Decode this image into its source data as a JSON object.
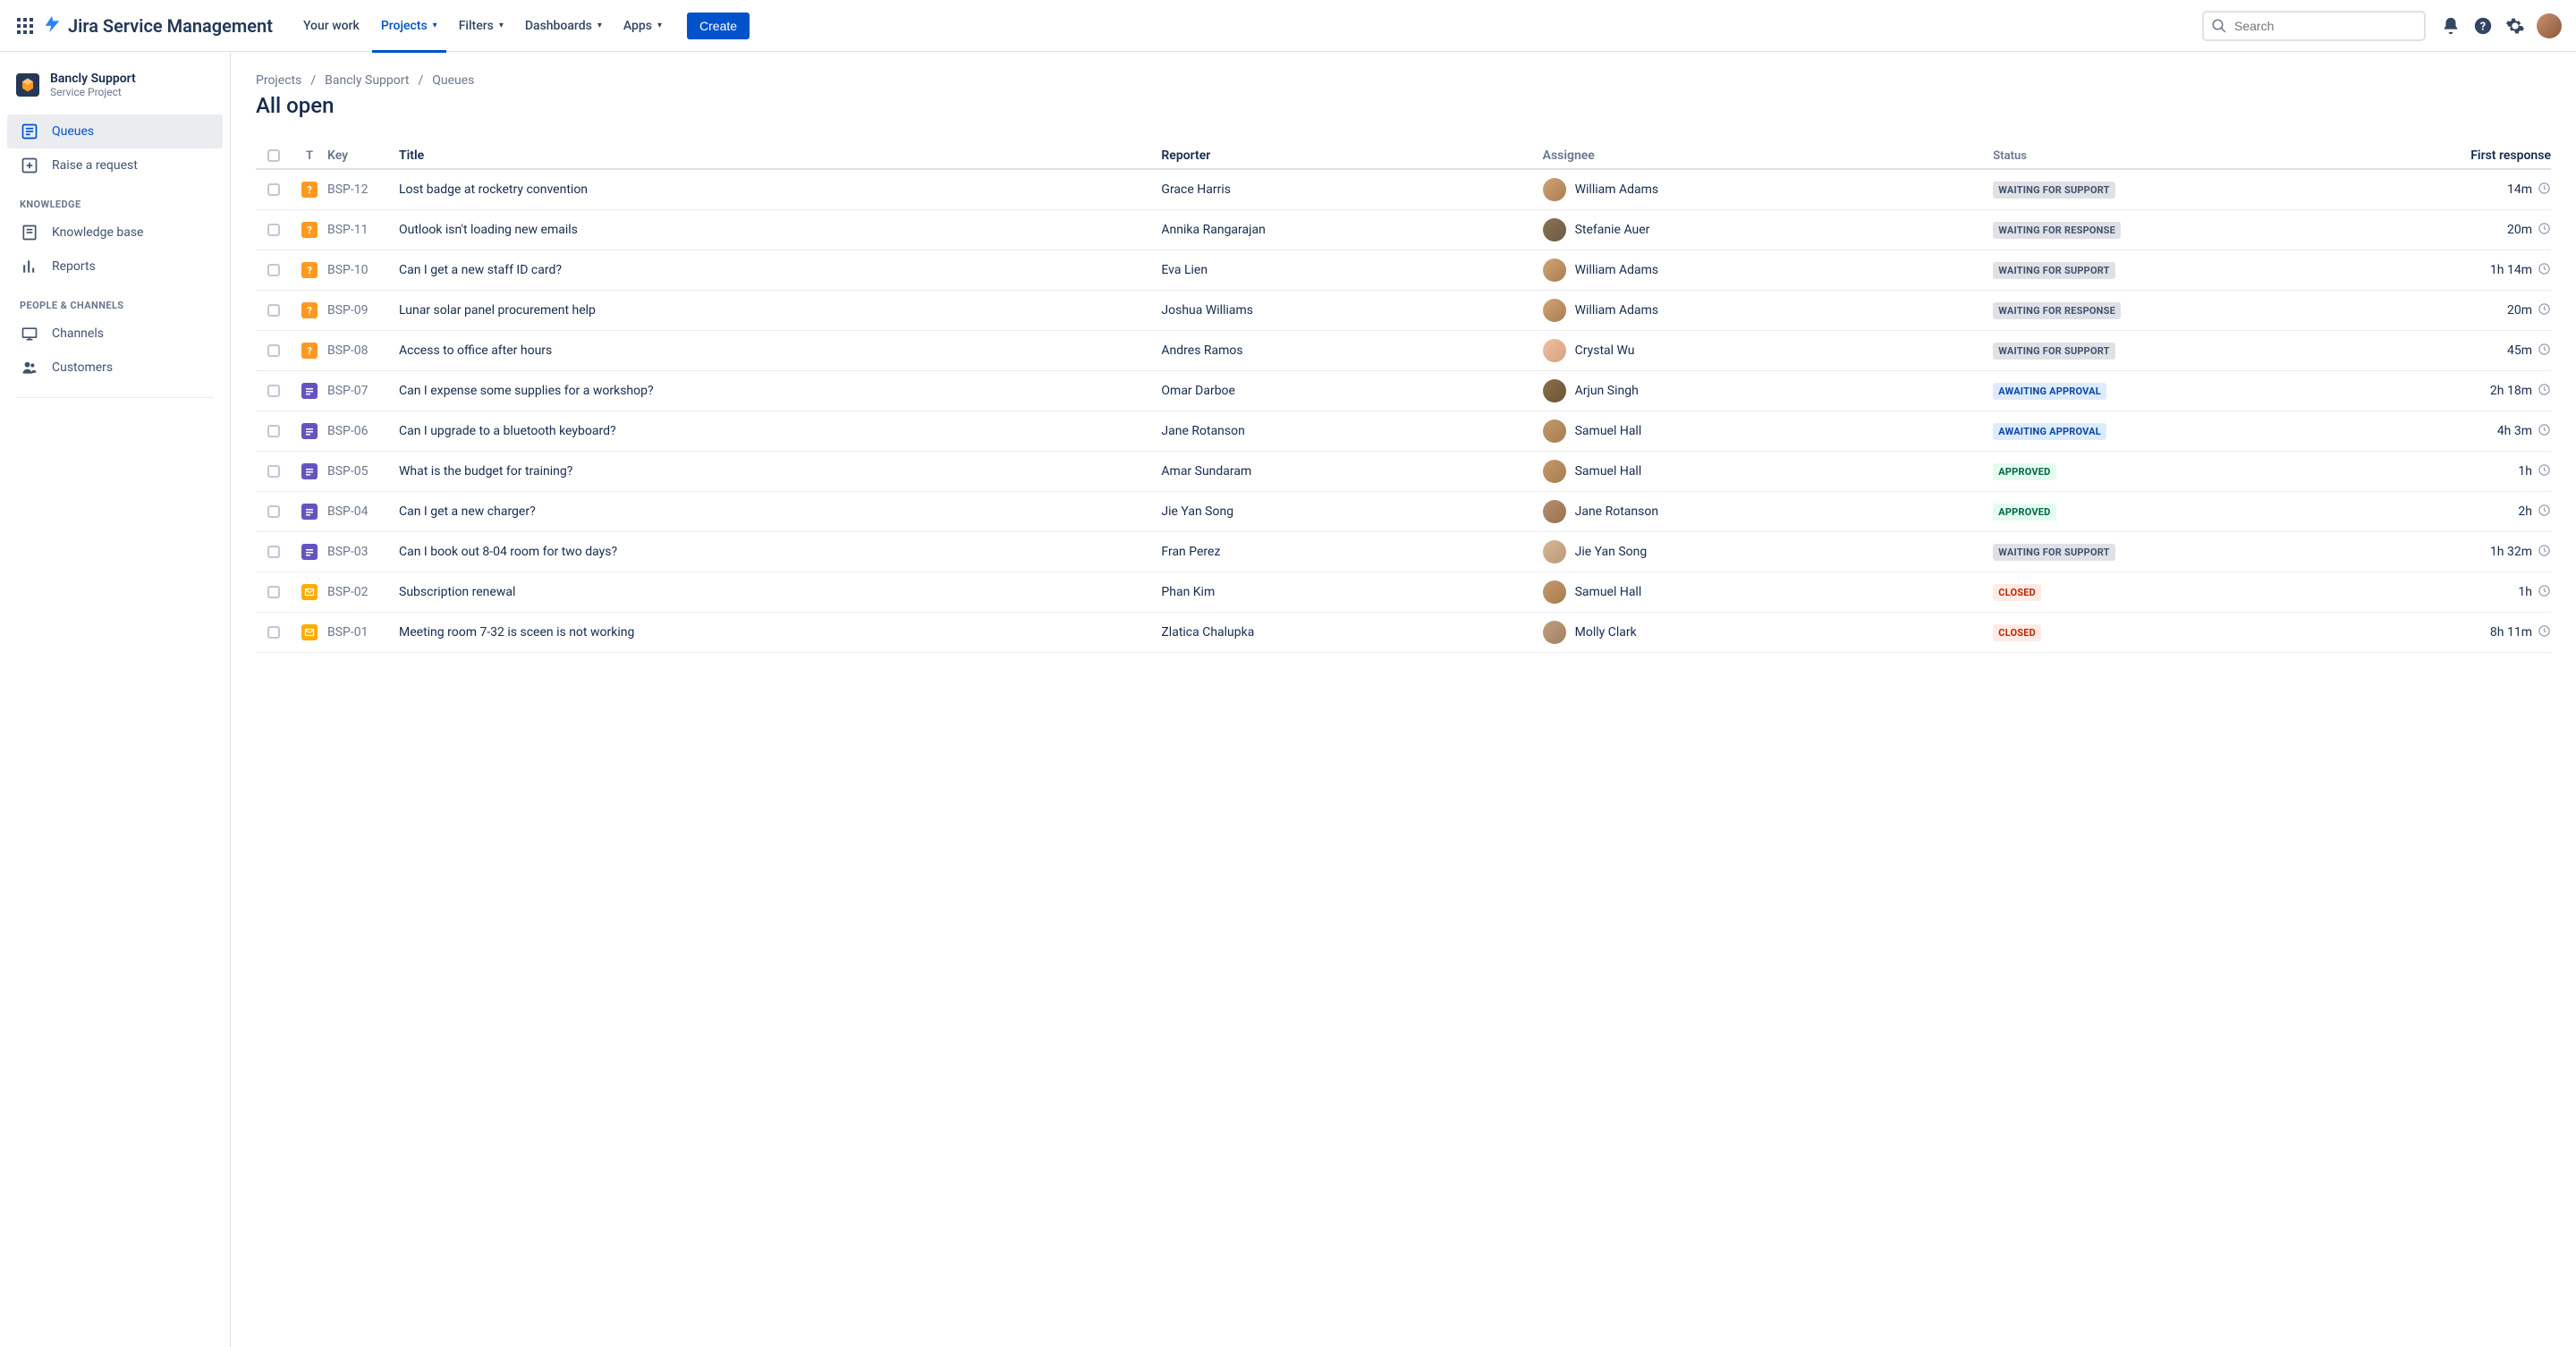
{
  "app": {
    "name": "Jira Service Management"
  },
  "nav": {
    "your_work": "Your work",
    "projects": "Projects",
    "filters": "Filters",
    "dashboards": "Dashboards",
    "apps": "Apps",
    "create": "Create"
  },
  "search": {
    "placeholder": "Search"
  },
  "project": {
    "name": "Bancly Support",
    "subtitle": "Service Project"
  },
  "sidebar": {
    "queues": "Queues",
    "raise": "Raise a request",
    "knowledge_h": "KNOWLEDGE",
    "kb": "Knowledge base",
    "reports": "Reports",
    "people_h": "PEOPLE & CHANNELS",
    "channels": "Channels",
    "customers": "Customers"
  },
  "breadcrumbs": {
    "a": "Projects",
    "b": "Bancly Support",
    "c": "Queues"
  },
  "page_title": "All open",
  "cols": {
    "t": "T",
    "key": "Key",
    "title": "Title",
    "reporter": "Reporter",
    "assignee": "Assignee",
    "status": "Status",
    "first": "First response"
  },
  "rows": [
    {
      "type": "orange",
      "key": "BSP-12",
      "title": "Lost badge at rocketry convention",
      "reporter": "Grace Harris",
      "assignee": "William Adams",
      "status": "WAITING FOR SUPPORT",
      "status_class": "st-waiting-support",
      "first": "14m",
      "ac": "linear-gradient(135deg,#d4a574,#a67c52)"
    },
    {
      "type": "orange",
      "key": "BSP-11",
      "title": "Outlook isn't loading new emails",
      "reporter": "Annika Rangarajan",
      "assignee": "Stefanie Auer",
      "status": "WAITING FOR RESPONSE",
      "status_class": "st-waiting-response",
      "first": "20m",
      "ac": "linear-gradient(135deg,#8b7355,#6b5a42)"
    },
    {
      "type": "orange",
      "key": "BSP-10",
      "title": "Can I get a new staff ID card?",
      "reporter": "Eva Lien",
      "assignee": "William Adams",
      "status": "WAITING FOR SUPPORT",
      "status_class": "st-waiting-support",
      "first": "1h 14m",
      "ac": "linear-gradient(135deg,#d4a574,#a67c52)"
    },
    {
      "type": "orange",
      "key": "BSP-09",
      "title": "Lunar solar panel procurement help",
      "reporter": "Joshua Williams",
      "assignee": "William Adams",
      "status": "WAITING FOR RESPONSE",
      "status_class": "st-waiting-response",
      "first": "20m",
      "ac": "linear-gradient(135deg,#d4a574,#a67c52)"
    },
    {
      "type": "orange",
      "key": "BSP-08",
      "title": "Access to office after hours",
      "reporter": "Andres Ramos",
      "assignee": "Crystal Wu",
      "status": "WAITING FOR SUPPORT",
      "status_class": "st-waiting-support",
      "first": "45m",
      "ac": "linear-gradient(135deg,#f0c0a0,#d4a080)"
    },
    {
      "type": "purple",
      "key": "BSP-07",
      "title": "Can I expense some supplies for a workshop?",
      "reporter": "Omar Darboe",
      "assignee": "Arjun Singh",
      "status": "AWAITING APPROVAL",
      "status_class": "st-awaiting-approval",
      "first": "2h 18m",
      "ac": "linear-gradient(135deg,#8b6f47,#6b5537)"
    },
    {
      "type": "purple",
      "key": "BSP-06",
      "title": "Can I upgrade to a bluetooth keyboard?",
      "reporter": "Jane Rotanson",
      "assignee": "Samuel Hall",
      "status": "AWAITING APPROVAL",
      "status_class": "st-awaiting-approval",
      "first": "4h 3m",
      "ac": "linear-gradient(135deg,#c49a6c,#a67c4e)"
    },
    {
      "type": "purple",
      "key": "BSP-05",
      "title": "What is the budget for training?",
      "reporter": "Amar Sundaram",
      "assignee": "Samuel Hall",
      "status": "APPROVED",
      "status_class": "st-approved",
      "first": "1h",
      "ac": "linear-gradient(135deg,#c49a6c,#a67c4e)"
    },
    {
      "type": "purple",
      "key": "BSP-04",
      "title": "Can I get a new charger?",
      "reporter": "Jie Yan Song",
      "assignee": "Jane Rotanson",
      "status": "APPROVED",
      "status_class": "st-approved",
      "first": "2h",
      "ac": "linear-gradient(135deg,#b89070,#987050)"
    },
    {
      "type": "purple",
      "key": "BSP-03",
      "title": "Can I book out 8-04 room for two days?",
      "reporter": "Fran Perez",
      "assignee": "Jie Yan Song",
      "status": "WAITING FOR SUPPORT",
      "status_class": "st-waiting-support",
      "first": "1h 32m",
      "ac": "linear-gradient(135deg,#d8b896,#b89876)"
    },
    {
      "type": "yellow",
      "key": "BSP-02",
      "title": "Subscription renewal",
      "reporter": "Phan Kim",
      "assignee": "Samuel Hall",
      "status": "CLOSED",
      "status_class": "st-closed",
      "first": "1h",
      "ac": "linear-gradient(135deg,#c49a6c,#a67c4e)"
    },
    {
      "type": "yellow",
      "key": "BSP-01",
      "title": "Meeting room 7-32 is sceen is not working",
      "reporter": "Zlatica Chalupka",
      "assignee": "Molly Clark",
      "status": "CLOSED",
      "status_class": "st-closed",
      "first": "8h 11m",
      "ac": "linear-gradient(135deg,#c0a080,#a08060)"
    }
  ]
}
